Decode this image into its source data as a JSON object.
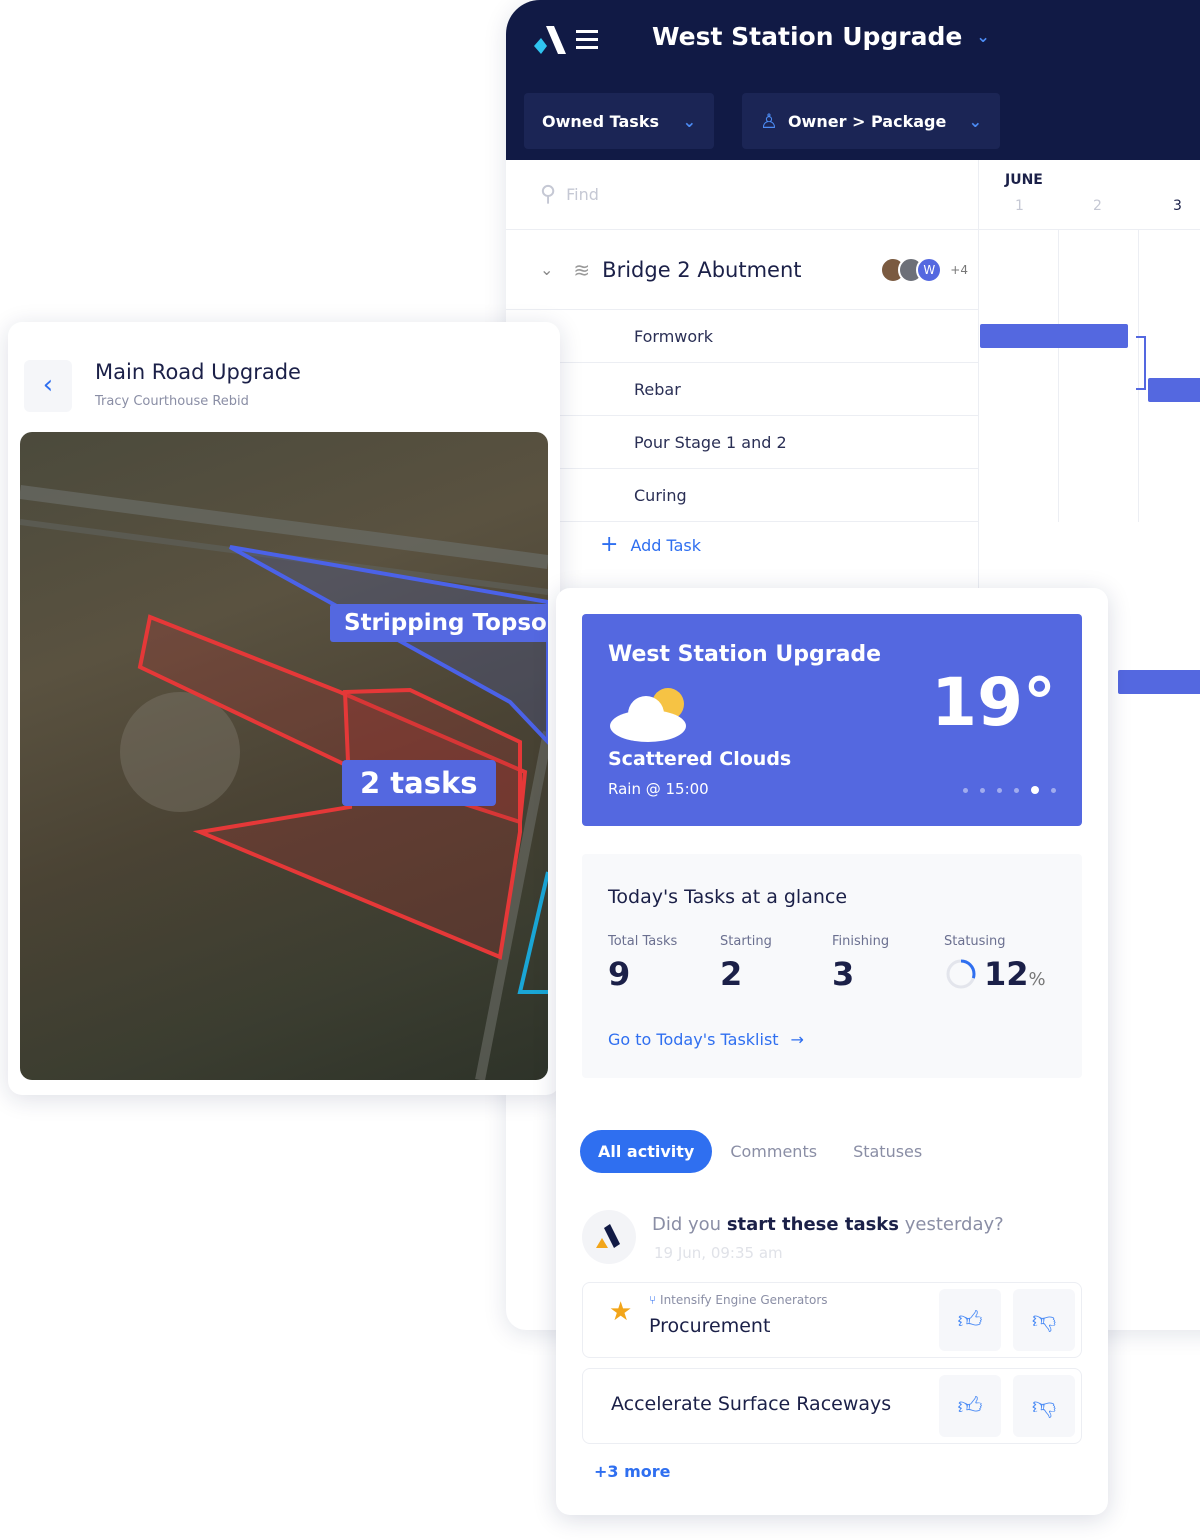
{
  "header": {
    "project_title": "West Station Upgrade",
    "filter1": "Owned Tasks",
    "filter2": "Owner > Package"
  },
  "list": {
    "search_placeholder": "Find",
    "group": {
      "title": "Bridge 2 Abutment",
      "avatar_letter": "W",
      "more_count": "+4"
    },
    "tasks": [
      "Formwork",
      "Rebar",
      "Pour Stage 1 and 2",
      "Curing"
    ],
    "add_task": "Add Task"
  },
  "gantt": {
    "month": "JUNE",
    "days": [
      "1",
      "2",
      "3"
    ]
  },
  "map_card": {
    "title": "Main Road Upgrade",
    "subtitle": "Tracy Courthouse Rebid",
    "label1": "Stripping Topsoil",
    "label2": "2 tasks"
  },
  "weather": {
    "project": "West Station Upgrade",
    "temperature": "19°",
    "condition": "Scattered Clouds",
    "rain": "Rain @ 15:00",
    "icon": "partly-cloudy-icon",
    "color": "#5468e0",
    "pages": 6,
    "active_page": 5
  },
  "glance": {
    "title": "Today's Tasks at a glance",
    "stats": [
      {
        "label": "Total Tasks",
        "value": "9"
      },
      {
        "label": "Starting",
        "value": "2"
      },
      {
        "label": "Finishing",
        "value": "3"
      }
    ],
    "statusing": {
      "label": "Statusing",
      "value": "12",
      "unit": "%",
      "percent": 12
    },
    "link": "Go to Today's Tasklist"
  },
  "activity": {
    "tabs": [
      "All activity",
      "Comments",
      "Statuses"
    ],
    "active_tab": 0,
    "question": {
      "pre": "Did you ",
      "bold": "start these tasks",
      "post": " yesterday?"
    },
    "timestamp": "19 Jun, 09:35 am",
    "items": [
      {
        "parent": "Intensify Engine Generators",
        "title": "Procurement",
        "starred": true
      },
      {
        "title": "Accelerate Surface Raceways",
        "starred": false
      }
    ],
    "more": "+3 more"
  }
}
